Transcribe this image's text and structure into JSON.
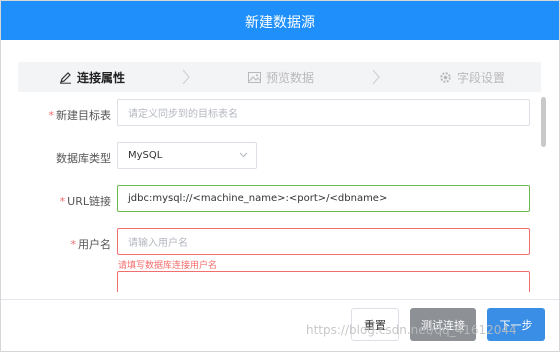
{
  "dialog": {
    "title": "新建数据源"
  },
  "steps": [
    {
      "label": "连接属性",
      "icon": "edit-icon",
      "active": true
    },
    {
      "label": "预览数据",
      "icon": "image-icon",
      "active": false
    },
    {
      "label": "字段设置",
      "icon": "gear-icon",
      "active": false
    }
  ],
  "form": {
    "target_table": {
      "label": "新建目标表",
      "required": true,
      "placeholder": "请定义同步到的目标表名"
    },
    "db_type": {
      "label": "数据库类型",
      "required": false,
      "value": "MySQL"
    },
    "url": {
      "label": "URL链接",
      "required": true,
      "value": "jdbc:mysql://<machine_name>:<port>/<dbname>"
    },
    "username": {
      "label": "用户名",
      "required": true,
      "placeholder": "请输入用户名",
      "error": "请填写数据库连接用户名"
    }
  },
  "footer": {
    "reset": "重置",
    "test": "测试连接",
    "next": "下一步"
  },
  "watermark": "https://blog.csdn.net/qq_41612044",
  "colors": {
    "header": "#1e8ffb",
    "primary": "#3a8ee6",
    "error": "#f56c6c",
    "success_border": "#6abb4a"
  }
}
